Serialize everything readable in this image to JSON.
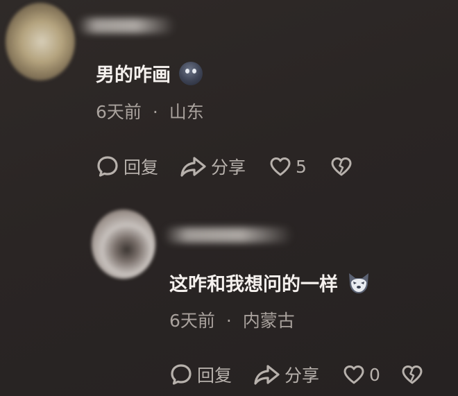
{
  "comments": [
    {
      "text": "男的咋画",
      "emoji": "moon-face-emoji",
      "time": "6天前",
      "location": "山东",
      "reply_label": "回复",
      "share_label": "分享",
      "like_count": "5",
      "separator": "·"
    },
    {
      "text": "这咋和我想问的一样",
      "emoji": "wolf-face-emoji",
      "time": "6天前",
      "location": "内蒙古",
      "reply_label": "回复",
      "share_label": "分享",
      "like_count": "0",
      "separator": "·"
    }
  ],
  "icons": {
    "reply": "speech-bubble-icon",
    "share": "share-arrow-icon",
    "like": "heart-icon",
    "dislike": "broken-heart-icon"
  },
  "colors": {
    "background": "#2a2524",
    "primary_text": "#f5f1ee",
    "secondary_text": "#a9a29d",
    "action_text": "#b7b1ac"
  }
}
